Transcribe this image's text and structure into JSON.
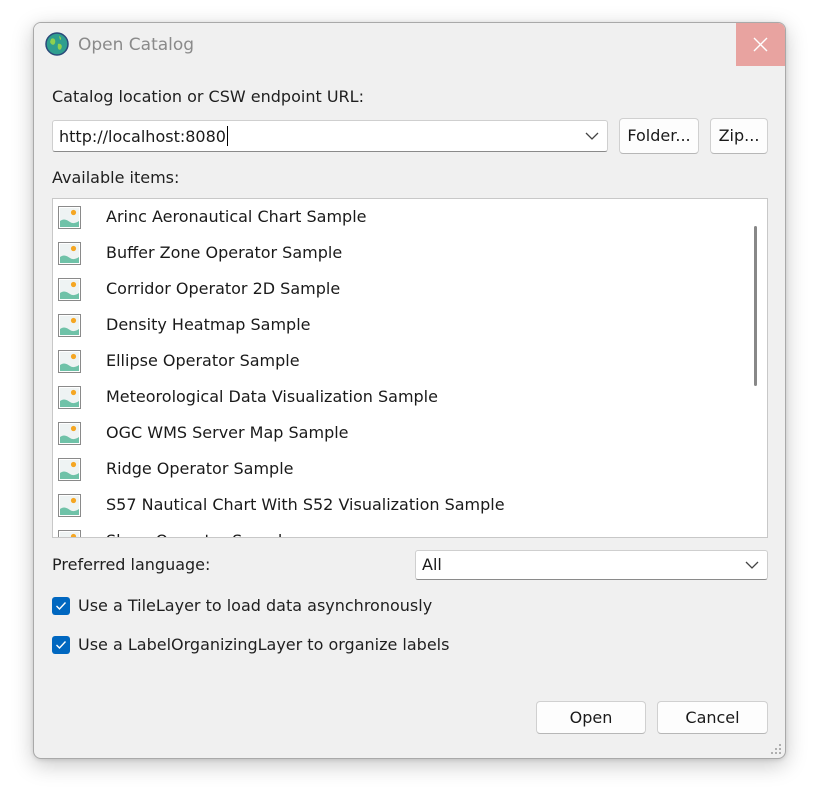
{
  "window": {
    "title": "Open Catalog"
  },
  "catalog": {
    "label": "Catalog location or CSW endpoint URL:",
    "url_value": "http://localhost:8080",
    "folder_button": "Folder...",
    "zip_button": "Zip..."
  },
  "items": {
    "label": "Available items:",
    "list": [
      "Arinc Aeronautical Chart Sample",
      "Buffer Zone Operator Sample",
      "Corridor Operator 2D Sample",
      "Density Heatmap Sample",
      "Ellipse Operator Sample",
      "Meteorological Data Visualization Sample",
      "OGC WMS Server Map Sample",
      "Ridge Operator Sample",
      "S57 Nautical Chart With S52 Visualization Sample",
      "Slope Operator Sample"
    ]
  },
  "language": {
    "label": "Preferred language:",
    "selected": "All"
  },
  "options": {
    "tile_layer_label": "Use a TileLayer to load data asynchronously",
    "tile_layer_checked": true,
    "label_org_label": "Use a LabelOrganizingLayer to organize labels",
    "label_org_checked": true
  },
  "actions": {
    "open": "Open",
    "cancel": "Cancel"
  },
  "colors": {
    "accent": "#0067c0",
    "close_hover": "#e8a3a0"
  }
}
